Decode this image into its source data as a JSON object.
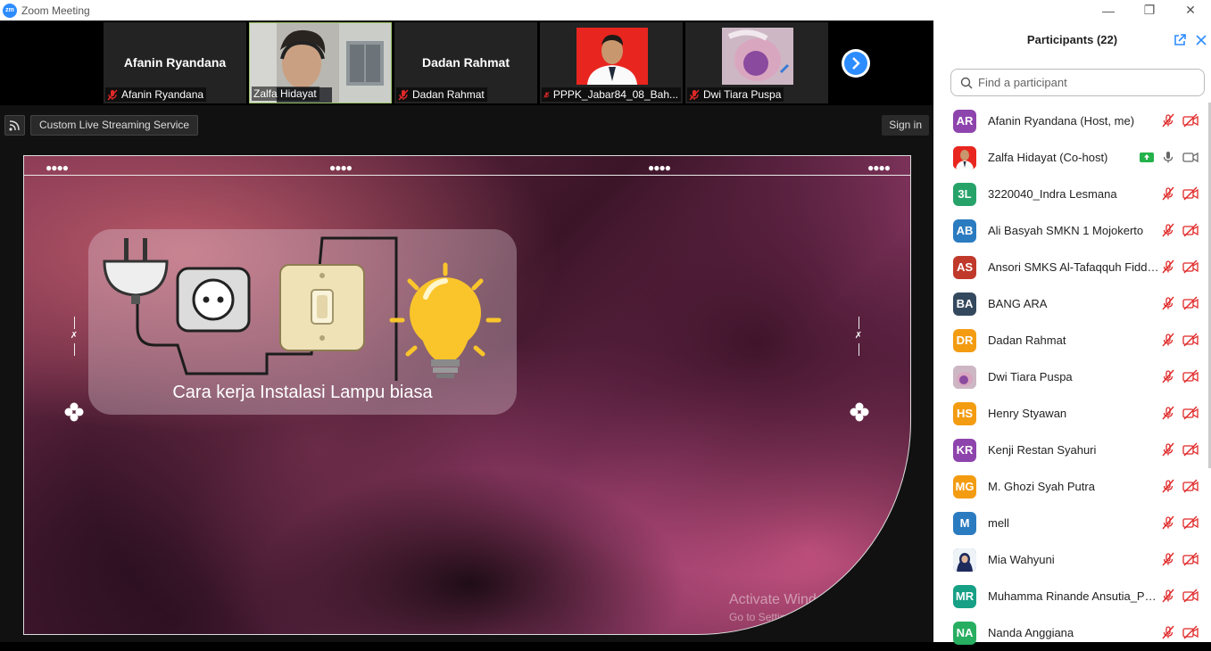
{
  "window": {
    "logo_text": "zm",
    "title": "Zoom Meeting",
    "minimize": "—",
    "restore": "❐",
    "close": "✕"
  },
  "video_strip": {
    "tiles": [
      {
        "big_name": "Afanin Ryandana",
        "label": "Afanin Ryandana",
        "muted": true
      },
      {
        "big_name": "",
        "label": "Zalfa Hidayat",
        "muted": false
      },
      {
        "big_name": "Dadan Rahmat",
        "label": "Dadan Rahmat",
        "muted": true
      },
      {
        "big_name": "",
        "label": "PPPK_Jabar84_08_Bah...",
        "muted": true
      },
      {
        "big_name": "",
        "label": "Dwi Tiara Puspa",
        "muted": true
      }
    ]
  },
  "toolbar": {
    "stream_label": "Custom Live Streaming Service",
    "signin_label": "Sign in"
  },
  "slide": {
    "caption": "Cara kerja Instalasi Lampu biasa"
  },
  "watermark": {
    "line1": "Activate Windows",
    "line2": "Go to Settings to activate Windows."
  },
  "participants": {
    "title": "Participants (22)",
    "search_placeholder": "Find a participant",
    "list": [
      {
        "initials": "AR",
        "name": "Afanin Ryandana (Host, me)",
        "color": "#8e44ad"
      },
      {
        "initials": "",
        "name": "Zalfa Hidayat (Co-host)",
        "color": "#c0392b",
        "photo": true
      },
      {
        "initials": "3L",
        "name": "3220040_Indra Lesmana",
        "color": "#27a36a"
      },
      {
        "initials": "AB",
        "name": "Ali Basyah SMKN 1 Mojokerto",
        "color": "#2b7bc0"
      },
      {
        "initials": "AS",
        "name": "Ansori SMKS Al-Tafaqquh Fiddi...",
        "color": "#c0392b"
      },
      {
        "initials": "BA",
        "name": "BANG ARA",
        "color": "#34495e"
      },
      {
        "initials": "DR",
        "name": "Dadan Rahmat",
        "color": "#f39c12"
      },
      {
        "initials": "",
        "name": "Dwi Tiara Puspa",
        "color": "#b9a0b8",
        "photo": true
      },
      {
        "initials": "HS",
        "name": "Henry Styawan",
        "color": "#f39c12"
      },
      {
        "initials": "KR",
        "name": "Kenji Restan Syahuri",
        "color": "#8e44ad"
      },
      {
        "initials": "MG",
        "name": "M. Ghozi Syah Putra",
        "color": "#f39c12"
      },
      {
        "initials": "M",
        "name": "mell",
        "color": "#2b7bc0"
      },
      {
        "initials": "",
        "name": "Mia Wahyuni",
        "color": "#2c3e80",
        "photo": true
      },
      {
        "initials": "MR",
        "name": "Muhamma Rinande Ansutia_PP...",
        "color": "#16a085"
      },
      {
        "initials": "NA",
        "name": "Nanda  Anggiana",
        "color": "#27ae60"
      }
    ]
  }
}
